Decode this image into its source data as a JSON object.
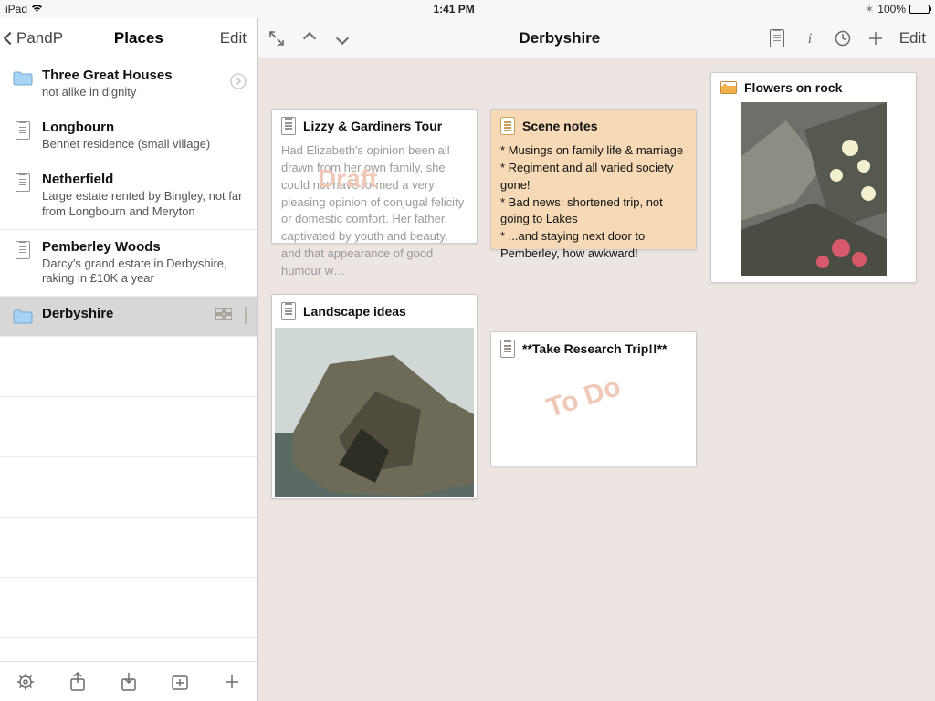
{
  "status": {
    "device": "iPad",
    "time": "1:41 PM",
    "battery": "100%",
    "bluetooth": "*"
  },
  "sidebar": {
    "back_label": "PandP",
    "title": "Places",
    "edit": "Edit",
    "items": [
      {
        "title": "Three Great Houses",
        "subtitle": "not alike in dignity",
        "type": "folder",
        "disclosure": true
      },
      {
        "title": "Longbourn",
        "subtitle": "Bennet residence (small village)",
        "type": "doc"
      },
      {
        "title": "Netherfield",
        "subtitle": "Large estate rented by Bingley, not far from Longbourn and Meryton",
        "type": "doc"
      },
      {
        "title": "Pemberley Woods",
        "subtitle": "Darcy's grand estate in Derbyshire, raking in £10K a year",
        "type": "doc"
      },
      {
        "title": "Derbyshire",
        "subtitle": "",
        "type": "folder",
        "selected": true,
        "grid": true,
        "disclosure": true
      }
    ]
  },
  "main": {
    "title": "Derbyshire",
    "edit": "Edit"
  },
  "cards": {
    "lizzy": {
      "title": "Lizzy & Gardiners Tour",
      "body": "Had Elizabeth's opinion been all drawn from her own family, she could not have formed a very pleasing opinion of conjugal felicity or domestic comfort. Her father, captivated by youth and beauty, and that appearance of good humour w…",
      "status": "Draft"
    },
    "scene": {
      "title": "Scene notes",
      "lines": [
        "* Musings on family life & marriage",
        "* Regiment and all varied society gone!",
        "* Bad news: shortened trip, not going to Lakes",
        "* ...and staying next door to Pemberley, how awkward!"
      ]
    },
    "flowers": {
      "title": "Flowers on rock"
    },
    "landscape": {
      "title": "Landscape ideas"
    },
    "research": {
      "title": "**Take Research Trip!!**",
      "status": "To Do"
    }
  }
}
